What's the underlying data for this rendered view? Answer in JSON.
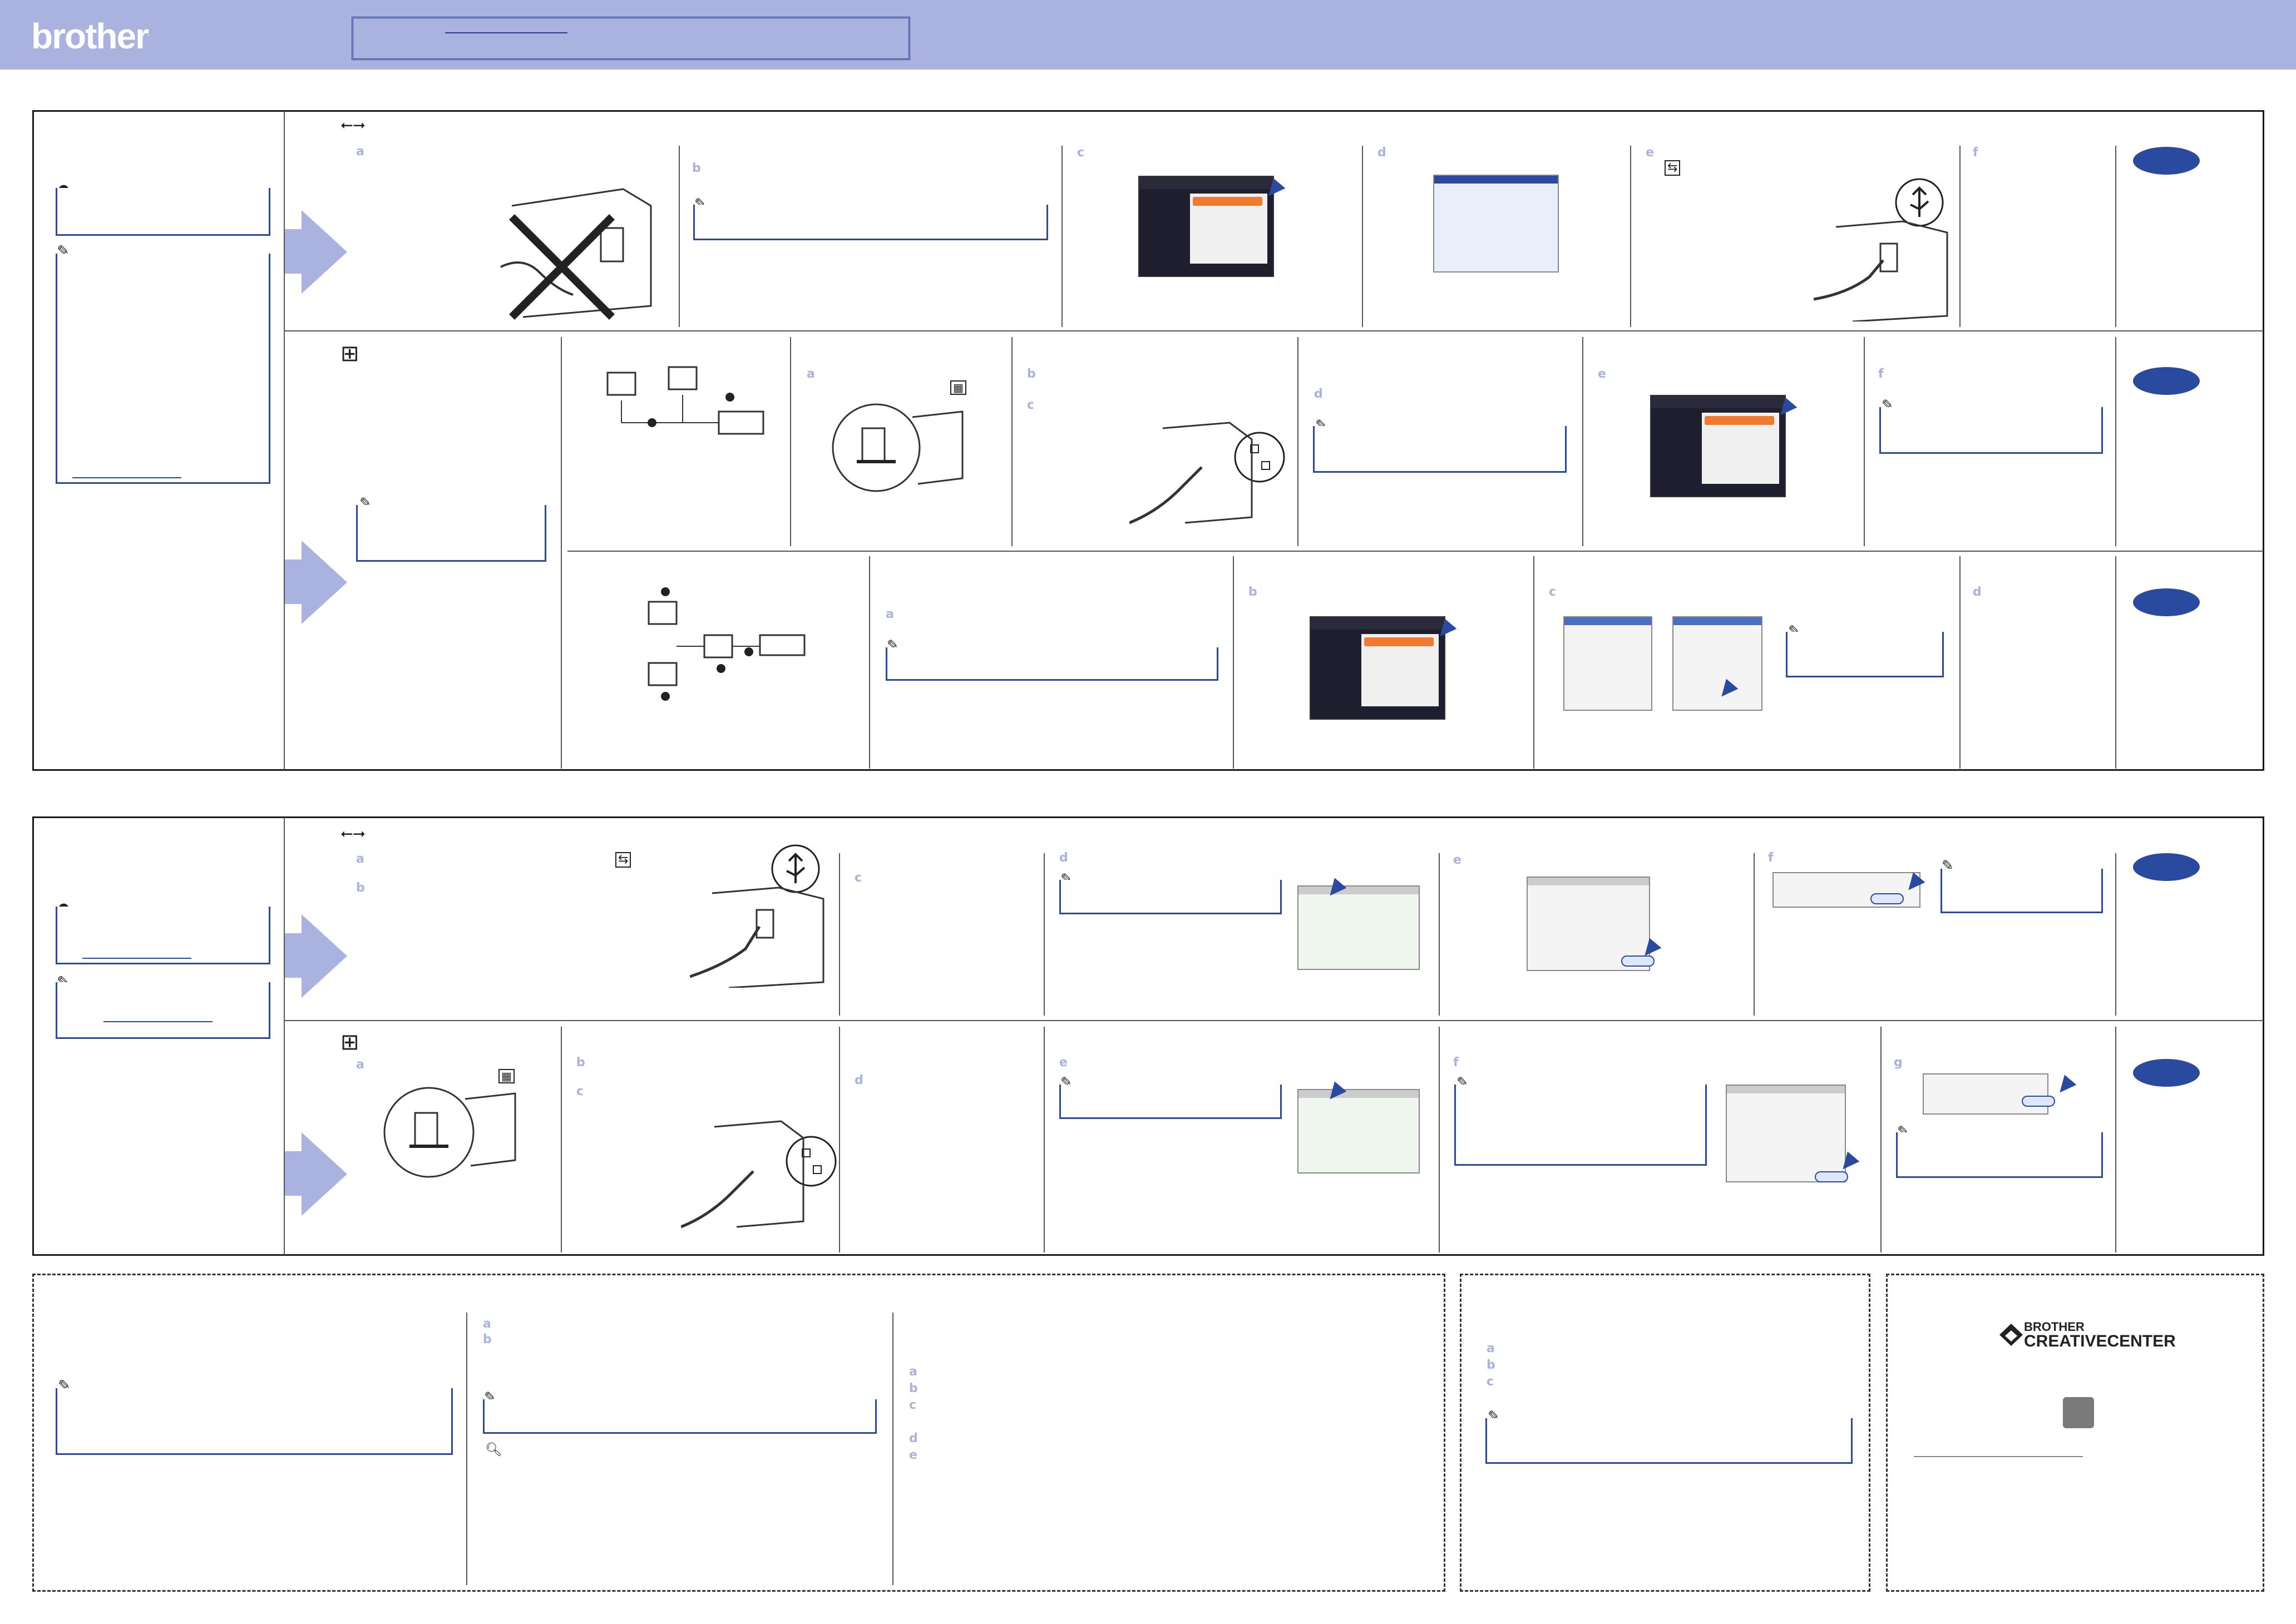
{
  "header": {
    "brand": "brother",
    "brand_mark": "."
  },
  "step_letters": {
    "a": "a",
    "b": "b",
    "c": "c",
    "d": "d",
    "e": "e",
    "f": "f",
    "g": "g"
  },
  "creative_center": {
    "line1": "BROTHER",
    "line2": "CREATIVECENTER"
  },
  "icons": {
    "usb": "usb-icon",
    "network": "network-icon",
    "important": "important-icon",
    "note": "note-pencil-icon",
    "search": "magnifier-icon"
  },
  "colors": {
    "header": "#aab3e0",
    "accent_blue": "#2a4aa0",
    "highlight_orange": "#f07a30"
  }
}
